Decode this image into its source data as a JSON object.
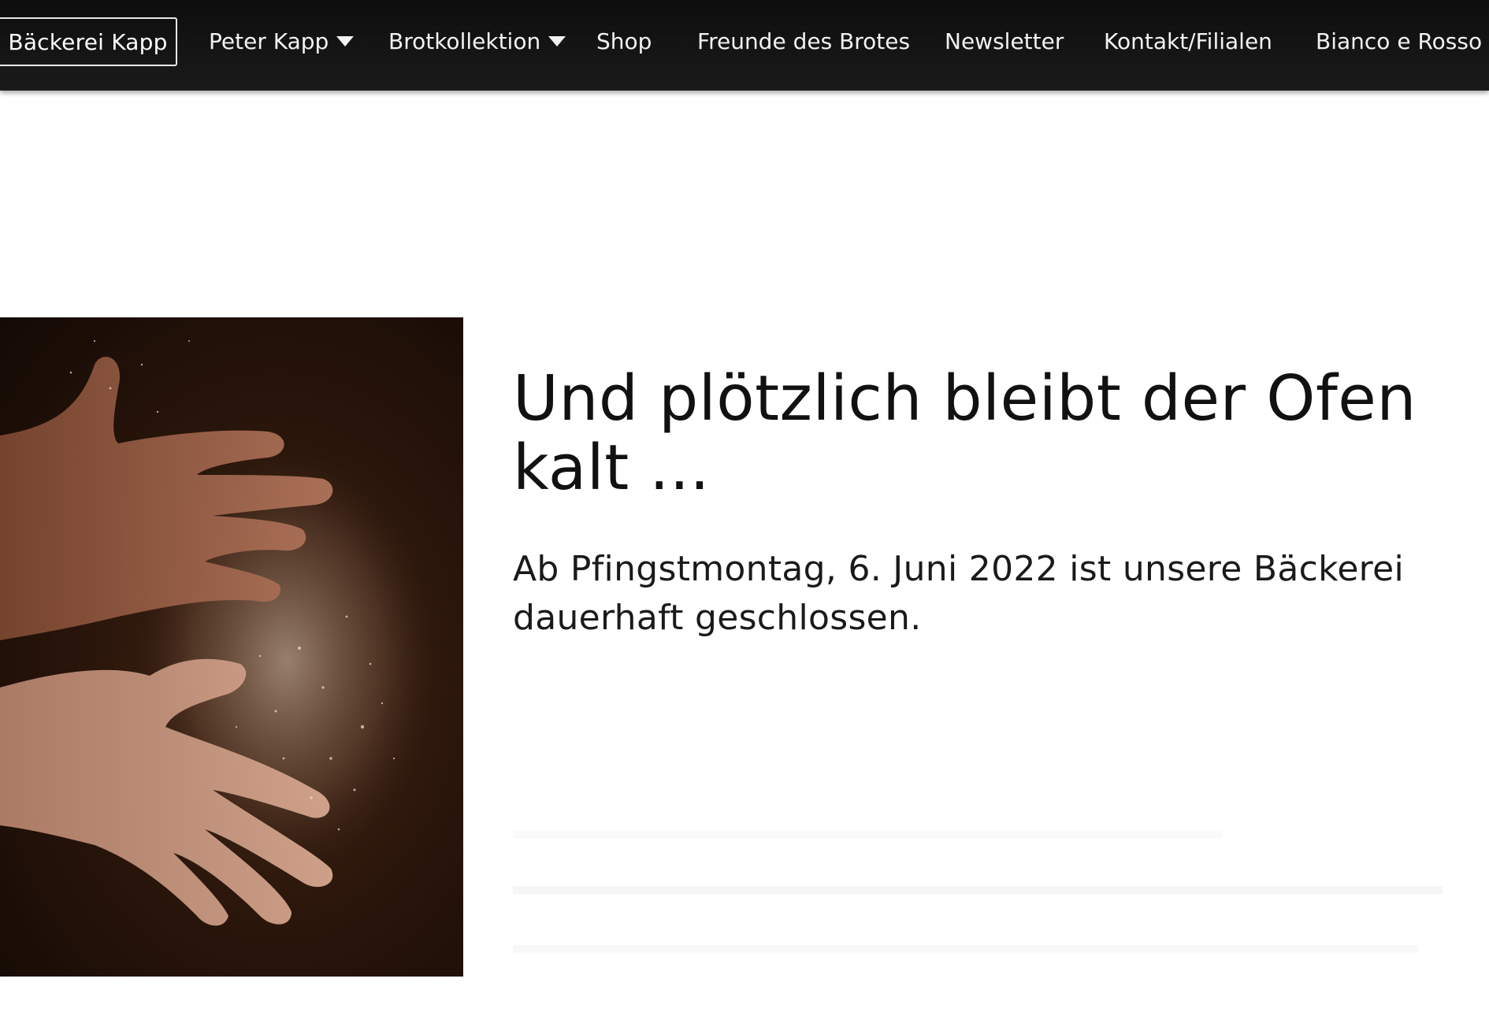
{
  "nav": {
    "brand": "Bäckerei Kapp",
    "items": [
      {
        "label": "Peter Kapp",
        "dropdown": true
      },
      {
        "label": "Brotkollektion",
        "dropdown": true
      },
      {
        "label": "Shop",
        "dropdown": false
      },
      {
        "label": "Freunde des Brotes",
        "dropdown": false
      },
      {
        "label": "Newsletter",
        "dropdown": false
      },
      {
        "label": "Kontakt/Filialen",
        "dropdown": false
      },
      {
        "label": "Bianco e Rosso",
        "dropdown": false
      }
    ]
  },
  "hero": {
    "image_subject": "flour-covered hands clapping"
  },
  "content": {
    "headline_line1": "Und plötzlich bleibt der Ofen",
    "headline_line2": "kalt ...",
    "subtext_line1": "Ab Pfingstmontag, 6. Juni 2022 ist unsere Bäckerei",
    "subtext_line2": "dauerhaft geschlossen."
  },
  "colors": {
    "nav_background": "#121212",
    "nav_text": "#f2f2f2",
    "body_text": "#111111",
    "page_background": "#ffffff"
  }
}
